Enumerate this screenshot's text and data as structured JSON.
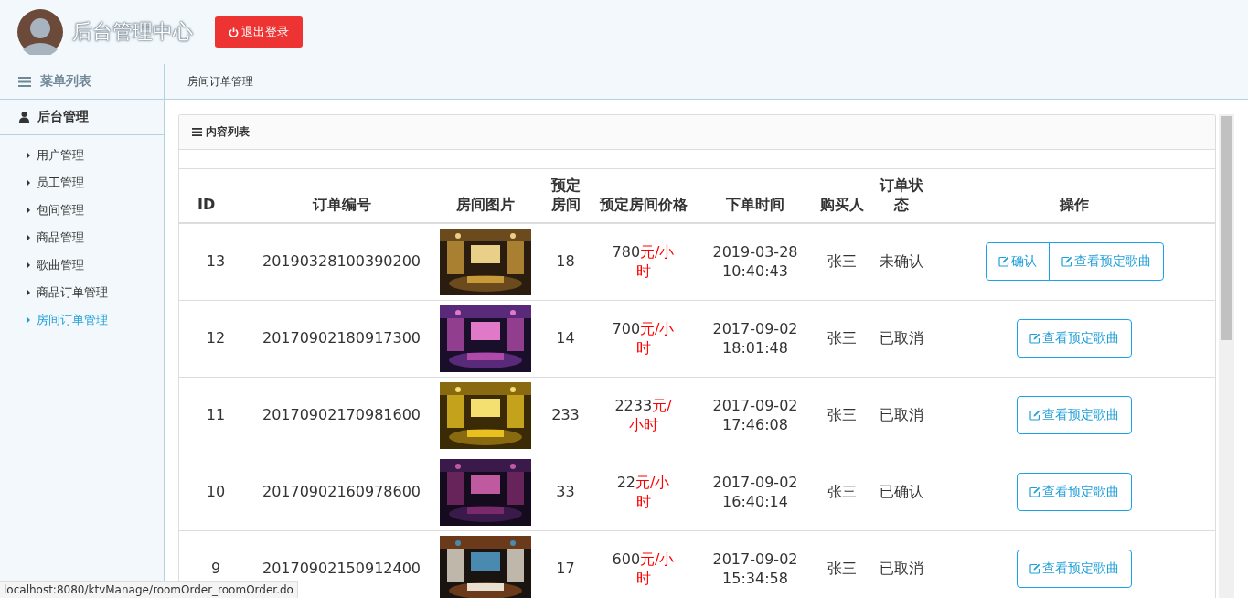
{
  "header": {
    "title": "后台管理中心",
    "logout_button": "退出登录"
  },
  "sidebar": {
    "title": "菜单列表",
    "section": "后台管理",
    "items": [
      {
        "label": "用户管理",
        "selected": false
      },
      {
        "label": "员工管理",
        "selected": false
      },
      {
        "label": "包间管理",
        "selected": false
      },
      {
        "label": "商品管理",
        "selected": false
      },
      {
        "label": "歌曲管理",
        "selected": false
      },
      {
        "label": "商品订单管理",
        "selected": false
      },
      {
        "label": "房间订单管理",
        "selected": true
      }
    ]
  },
  "breadcrumb": "房间订单管理",
  "panel": {
    "title": "内容列表"
  },
  "table": {
    "columns": [
      "ID",
      "订单编号",
      "房间图片",
      "预定房间",
      "预定房间价格",
      "下单时间",
      "购买人",
      "订单状态",
      "操作"
    ],
    "rows": [
      {
        "id": "13",
        "order_no": "20190328100390200",
        "image": {
          "kind": "picture"
        },
        "room": "18",
        "price": "780",
        "unit": "元/小时",
        "date": "2019-03-28",
        "time": "10:40:43",
        "buyer": "张三",
        "status": "未确认",
        "actions": [
          "确认",
          "查看预定歌曲"
        ]
      },
      {
        "id": "12",
        "order_no": "20170902180917300",
        "image": {
          "kind": "picture"
        },
        "room": "14",
        "price": "700",
        "unit": "元/小时",
        "date": "2017-09-02",
        "time": "18:01:48",
        "buyer": "张三",
        "status": "已取消",
        "actions": [
          "查看预定歌曲"
        ]
      },
      {
        "id": "11",
        "order_no": "20170902170981600",
        "image": {
          "kind": "picture"
        },
        "room": "233",
        "price": "2233",
        "unit": "元/小时",
        "date": "2017-09-02",
        "time": "17:46:08",
        "buyer": "张三",
        "status": "已取消",
        "actions": [
          "查看预定歌曲"
        ]
      },
      {
        "id": "10",
        "order_no": "20170902160978600",
        "image": {
          "kind": "picture"
        },
        "room": "33",
        "price": "22",
        "unit": "元/小时",
        "date": "2017-09-02",
        "time": "16:40:14",
        "buyer": "张三",
        "status": "已确认",
        "actions": [
          "查看预定歌曲"
        ]
      },
      {
        "id": "9",
        "order_no": "20170902150912400",
        "image": {
          "kind": "picture"
        },
        "room": "17",
        "price": "600",
        "unit": "元/小时",
        "date": "2017-09-02",
        "time": "15:34:58",
        "buyer": "张三",
        "status": "已取消",
        "actions": [
          "查看预定歌曲"
        ]
      }
    ]
  },
  "status_bar": "localhost:8080/ktvManage/roomOrder_roomOrder.do"
}
